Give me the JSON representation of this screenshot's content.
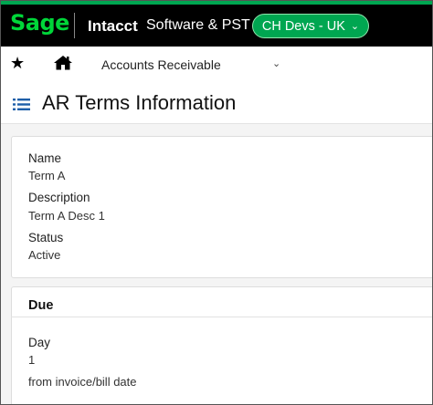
{
  "header": {
    "logo_text": "Sage",
    "brand": "Intacct",
    "company": "Software & PST",
    "entity_button": "CH Devs - UK",
    "accent_color": "#00a651"
  },
  "nav": {
    "favorites_icon": "star-icon",
    "home_icon": "home-icon",
    "module_label": "Accounts Receivable",
    "module_dropdown_icon": "chevron-down-icon"
  },
  "page": {
    "menu_icon": "list-icon",
    "title": "AR Terms Information"
  },
  "general": {
    "name_label": "Name",
    "name_value": "Term A",
    "description_label": "Description",
    "description_value": "Term A Desc 1",
    "status_label": "Status",
    "status_value": "Active"
  },
  "due": {
    "section_title": "Due",
    "day_label": "Day",
    "day_value": "1",
    "basis_text": "from invoice/bill date"
  }
}
